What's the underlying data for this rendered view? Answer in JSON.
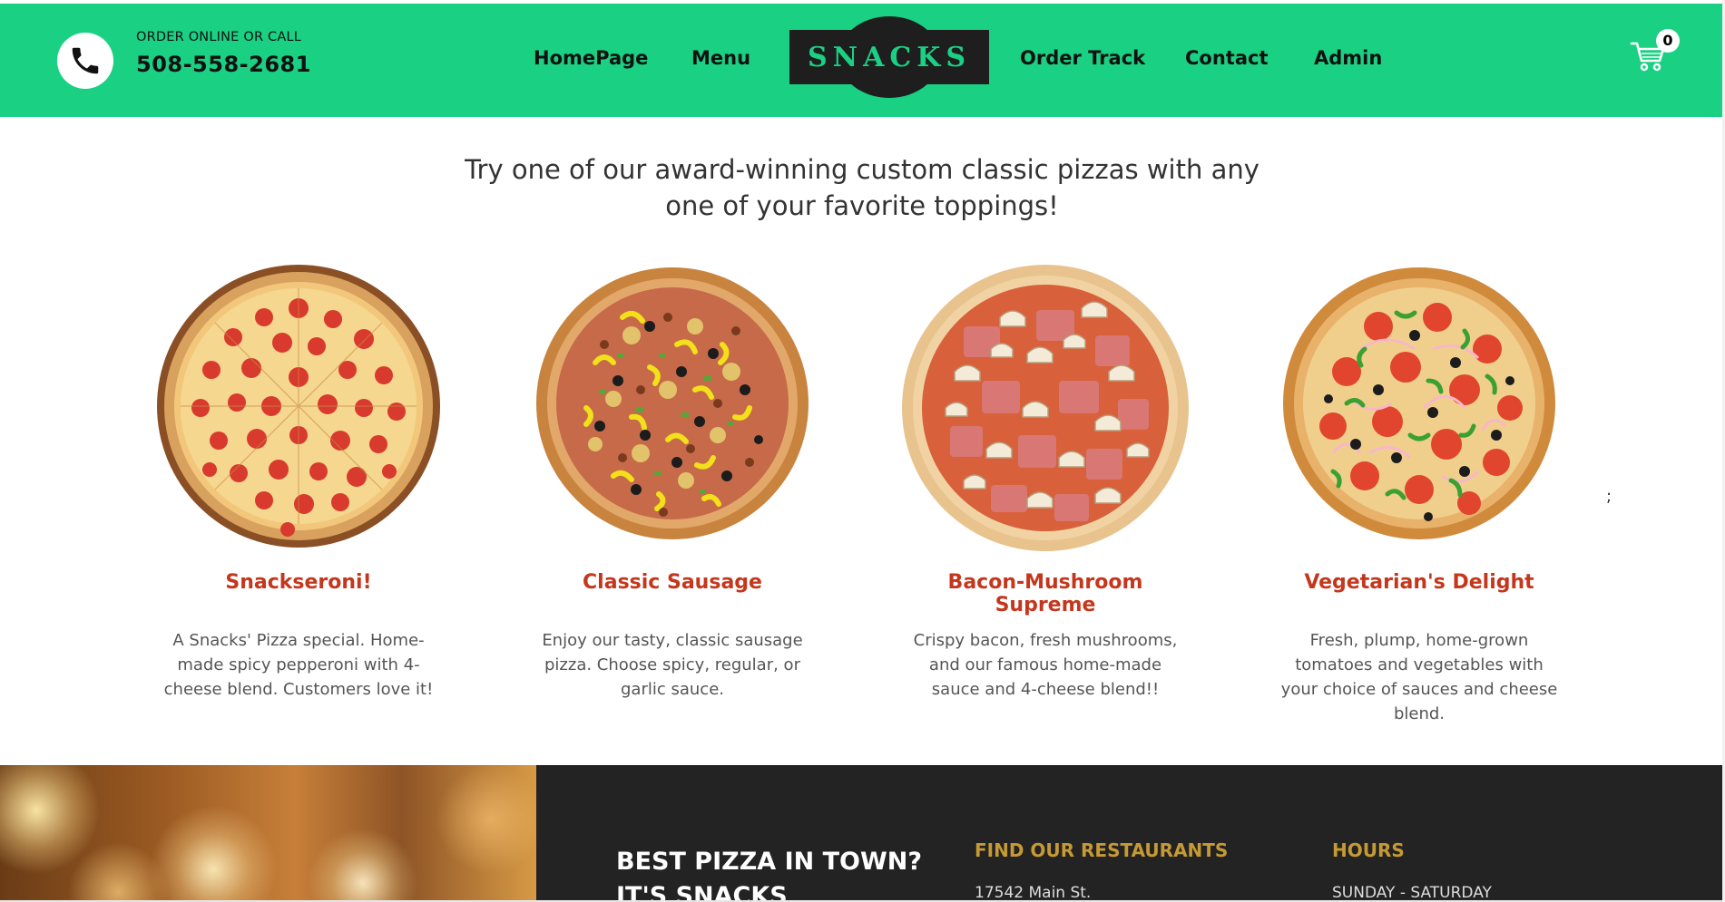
{
  "header": {
    "order_caption": "ORDER ONLINE OR CALL",
    "phone_number": "508-558-2681",
    "nav": [
      "HomePage",
      "Menu",
      "Order Track",
      "Contact",
      "Admin"
    ],
    "logo_text": "SNACKS",
    "cart_count": "0",
    "colors": {
      "bar": "#1ad083",
      "logo_bg": "#1e1e1e",
      "logo_text": "#1ad083"
    }
  },
  "intro": {
    "line1": "Try one of our award-winning custom classic pizzas with any",
    "line2": "one of your favorite toppings!"
  },
  "pizzas": [
    {
      "title": "Snackseroni!",
      "description": "A Snacks' Pizza special. Home-made spicy pepperoni with 4-cheese blend. Customers love it!",
      "image": "pepperoni-pizza"
    },
    {
      "title": "Classic Sausage",
      "description": "Enjoy our tasty, classic sausage pizza. Choose spicy, regular, or garlic sauce.",
      "image": "sausage-pepper-pizza"
    },
    {
      "title": "Bacon-Mushroom Supreme",
      "description": "Crispy bacon, fresh mushrooms, and our famous home-made sauce and 4-cheese blend!!",
      "image": "bacon-mushroom-pizza"
    },
    {
      "title": "Vegetarian's Delight",
      "description": "Fresh, plump, home-grown tomatoes and vegetables with your choice of sauces and cheese blend.",
      "image": "vegetarian-pizza"
    }
  ],
  "stray_text": ";",
  "footer": {
    "tagline_line1": "BEST PIZZA IN TOWN?",
    "tagline_line2": "IT'S SNACKS",
    "restaurants_heading": "FIND OUR RESTAURANTS",
    "restaurants_address": "17542 Main St.",
    "hours_heading": "HOURS",
    "hours_days": "SUNDAY - SATURDAY",
    "colors": {
      "dark": "#232323",
      "heading": "#c59a35"
    }
  },
  "colors": {
    "accent": "#1ad083",
    "pizza_title": "#c4371d"
  }
}
